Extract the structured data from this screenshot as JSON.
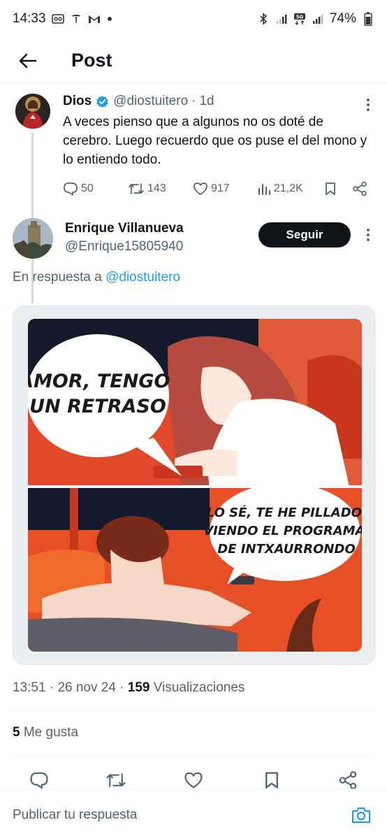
{
  "status_bar": {
    "time": "14:33",
    "battery": "74%"
  },
  "header": {
    "title": "Post"
  },
  "original_tweet": {
    "author_name": "Dios",
    "handle": "@diostuitero",
    "separator": "·",
    "time": "1d",
    "text": "A veces pienso que a algunos no os doté de cerebro. Luego recuerdo que os puse el del mono y lo entiendo todo.",
    "replies": "50",
    "retweets": "143",
    "likes": "917",
    "views": "21,2K"
  },
  "reply": {
    "author_name": "Enrique Villanueva",
    "handle": "@Enrique15805940",
    "follow_label": "Seguir",
    "reply_prefix": "En respuesta a",
    "reply_mention": "@diostuitero",
    "meme": {
      "bubble_top": "AMOR, TENGO UN RETRASO",
      "bubble_bottom": "LO SÉ, TE HE PILLADO VIENDO EL PROGRAMA DE INTXAURRONDO"
    },
    "time": "13:51",
    "date": "26 nov 24",
    "views_count": "159",
    "views_label": "Visualizaciones",
    "likes_count": "5",
    "likes_label": "Me gusta"
  },
  "compose": {
    "placeholder": "Publicar tu respuesta"
  },
  "colors": {
    "accent": "#1d9bf0",
    "text": "#0f1419",
    "muted": "#536471",
    "follow_bg": "#0f1419"
  }
}
